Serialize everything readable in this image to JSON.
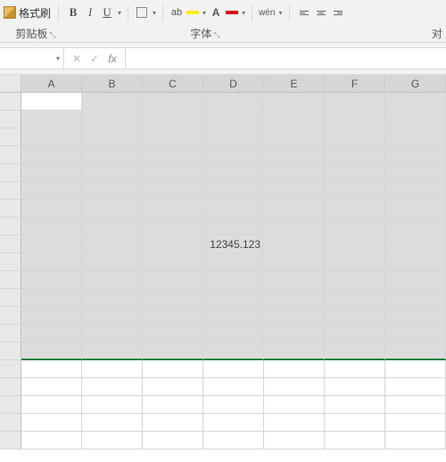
{
  "ribbon": {
    "format_painter": "格式刷",
    "bold": "B",
    "italic": "I",
    "underline": "U",
    "pinyin": "wén"
  },
  "group_labels": {
    "clipboard": "剪贴板",
    "font": "字体",
    "alignment": "对"
  },
  "formula_bar": {
    "namebox": "",
    "cancel": "✕",
    "confirm": "✓",
    "fx": "fx",
    "input": ""
  },
  "columns": [
    "A",
    "B",
    "C",
    "D",
    "E",
    "F",
    "G"
  ],
  "data_cell": {
    "row": 9,
    "col": "D",
    "value": "12345.123"
  },
  "selection": {
    "rows_from": 1,
    "rows_to": 15,
    "cols_from": "A",
    "cols_to": "G"
  },
  "total_rows": 20
}
